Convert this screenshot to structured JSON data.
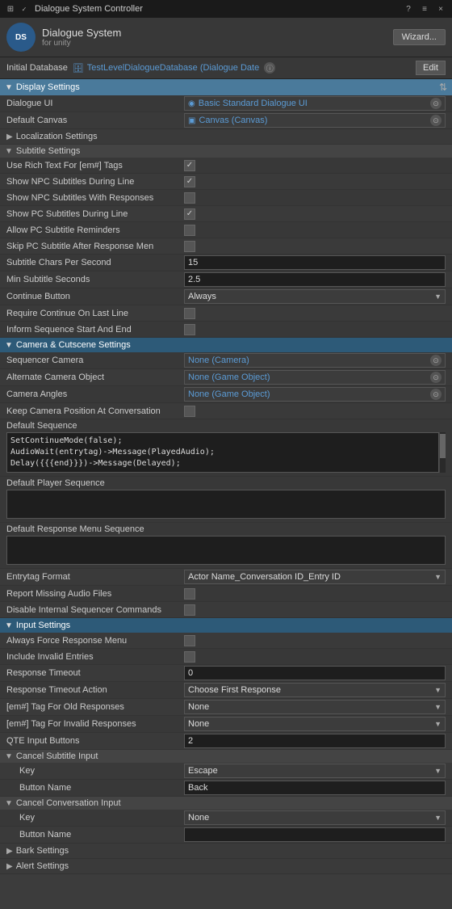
{
  "titleBar": {
    "icon": "⊞",
    "checkbox": true,
    "title": "Dialogue System Controller",
    "actions": [
      "?",
      "≡",
      "×"
    ]
  },
  "header": {
    "logoText": "DS",
    "titleMain": "Dialogue System",
    "titleSub": "for unity",
    "wizardLabel": "Wizard..."
  },
  "databaseRow": {
    "label": "Initial Database",
    "valueIcon": "🗄",
    "value": "TestLevelDialogueDatabase (Dialogue Date",
    "infoIcon": "ⓘ",
    "editLabel": "Edit"
  },
  "displaySettings": {
    "sectionLabel": "Display Settings",
    "dialogueUI": {
      "label": "Dialogue UI",
      "value": "Basic Standard Dialogue UI",
      "icon": "◉"
    },
    "defaultCanvas": {
      "label": "Default Canvas",
      "value": "Canvas (Canvas)",
      "icon": "▣"
    },
    "localizationSettings": {
      "label": "Localization Settings",
      "collapsed": true
    },
    "subtitleSettings": {
      "label": "Subtitle Settings",
      "fields": [
        {
          "label": "Use Rich Text For [em#] Tags",
          "type": "checkbox",
          "checked": true
        },
        {
          "label": "Show NPC Subtitles During Line",
          "type": "checkbox",
          "checked": true
        },
        {
          "label": "Show NPC Subtitles With Responses",
          "type": "checkbox",
          "checked": false
        },
        {
          "label": "Show PC Subtitles During Line",
          "type": "checkbox",
          "checked": true
        },
        {
          "label": "Allow PC Subtitle Reminders",
          "type": "checkbox",
          "checked": false
        },
        {
          "label": "Skip PC Subtitle After Response Men",
          "type": "checkbox",
          "checked": false
        },
        {
          "label": "Subtitle Chars Per Second",
          "type": "number",
          "value": "15"
        },
        {
          "label": "Min Subtitle Seconds",
          "type": "number",
          "value": "2.5"
        },
        {
          "label": "Continue Button",
          "type": "dropdown",
          "value": "Always"
        },
        {
          "label": "Require Continue On Last Line",
          "type": "checkbox",
          "checked": false
        },
        {
          "label": "Inform Sequence Start And End",
          "type": "checkbox",
          "checked": false
        }
      ]
    }
  },
  "cameraSettings": {
    "sectionLabel": "Camera & Cutscene Settings",
    "fields": [
      {
        "label": "Sequencer Camera",
        "type": "object",
        "value": "None (Camera)"
      },
      {
        "label": "Alternate Camera Object",
        "type": "object",
        "value": "None (Game Object)"
      },
      {
        "label": "Camera Angles",
        "type": "object",
        "value": "None (Game Object)"
      },
      {
        "label": "Keep Camera Position At Conversation",
        "type": "checkbox",
        "checked": false
      }
    ],
    "defaultSequence": {
      "label": "Default Sequence",
      "value": "SetContinueMode(false);\nAudioWait(entrytag)->Message(PlayedAudio);\nDelay({{{end}}})->Message(Delayed);"
    },
    "defaultPlayerSequence": {
      "label": "Default Player Sequence",
      "value": ""
    },
    "defaultResponseMenuSequence": {
      "label": "Default Response Menu Sequence",
      "value": ""
    },
    "entrytagFormat": {
      "label": "Entrytag Format",
      "value": "Actor Name_Conversation ID_Entry ID"
    },
    "reportMissingAudioFiles": {
      "label": "Report Missing Audio Files",
      "type": "checkbox",
      "checked": false
    },
    "disableInternalSequencerCommands": {
      "label": "Disable Internal Sequencer Commands",
      "type": "checkbox",
      "checked": false
    }
  },
  "inputSettings": {
    "sectionLabel": "Input Settings",
    "fields": [
      {
        "label": "Always Force Response Menu",
        "type": "checkbox",
        "checked": false
      },
      {
        "label": "Include Invalid Entries",
        "type": "checkbox",
        "checked": false
      },
      {
        "label": "Response Timeout",
        "type": "number",
        "value": "0"
      },
      {
        "label": "Response Timeout Action",
        "type": "dropdown",
        "value": "Choose First Response"
      },
      {
        "label": "[em#] Tag For Old Responses",
        "type": "dropdown",
        "value": "None"
      },
      {
        "label": "[em#] Tag For Invalid Responses",
        "type": "dropdown",
        "value": "None"
      },
      {
        "label": "QTE Input Buttons",
        "type": "number",
        "value": "2"
      }
    ],
    "cancelSubtitleInput": {
      "label": "Cancel Subtitle Input",
      "key": {
        "label": "Key",
        "value": "Escape"
      },
      "buttonName": {
        "label": "Button Name",
        "value": "Back"
      }
    },
    "cancelConversationInput": {
      "label": "Cancel Conversation Input",
      "key": {
        "label": "Key",
        "value": "None"
      },
      "buttonName": {
        "label": "Button Name",
        "value": ""
      }
    }
  },
  "bottomSections": [
    {
      "label": "Bark Settings",
      "collapsed": true
    },
    {
      "label": "Alert Settings",
      "collapsed": true
    }
  ]
}
